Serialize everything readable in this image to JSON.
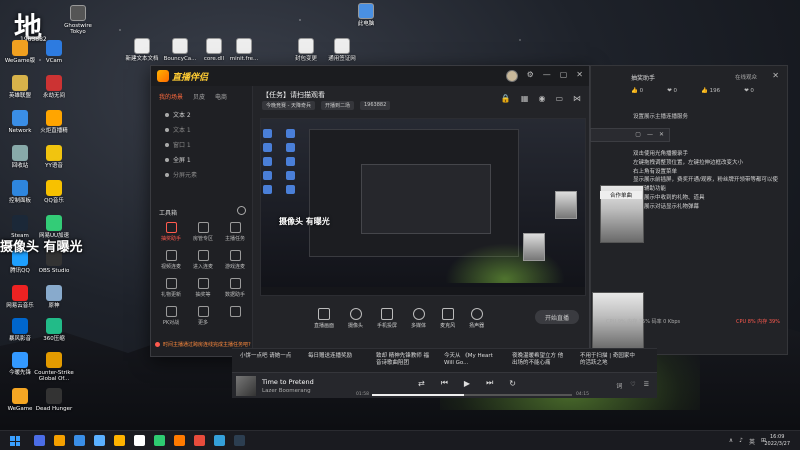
{
  "desktop": {
    "watermark": "摄像头 有曝光",
    "user_badge": {
      "glyph": "地",
      "text": "坐|观|于",
      "id": "1963882"
    },
    "icons": [
      {
        "label": "WeGame版",
        "color": "#f0a020"
      },
      {
        "label": "VCam",
        "color": "#2d7be0"
      },
      {
        "label": "英雄联盟",
        "color": "#d7b24a"
      },
      {
        "label": "永劫无间",
        "color": "#c33"
      },
      {
        "label": "Network",
        "color": "#3a8ee6"
      },
      {
        "label": "火炬直播精",
        "color": "#ffa500"
      },
      {
        "label": "回收站",
        "color": "#8aa"
      },
      {
        "label": "YY语音",
        "color": "#f1c40f"
      },
      {
        "label": "控制面板",
        "color": "#2e86de"
      },
      {
        "label": "QQ音乐",
        "color": "#f7c100"
      },
      {
        "label": "Steam",
        "color": "#1b2838"
      },
      {
        "label": "网易UU加速",
        "color": "#3c7"
      },
      {
        "label": "腾讯QQ",
        "color": "#1ea0ff"
      },
      {
        "label": "OBS Studio",
        "color": "#333"
      },
      {
        "label": "网易云音乐",
        "color": "#e22"
      },
      {
        "label": "原神",
        "color": "#8ac"
      },
      {
        "label": "暴风影音",
        "color": "#06c"
      },
      {
        "label": "360压缩",
        "color": "#2b8"
      },
      {
        "label": "今暖先锋",
        "color": "#39f"
      },
      {
        "label": "Counter-Strike Global Of...",
        "color": "#e39b00"
      },
      {
        "label": "WeGame",
        "color": "#f5a623"
      },
      {
        "label": "Dead Hunger",
        "color": "#333"
      }
    ],
    "top_icons": [
      {
        "label": "Ghostwire Tokyo",
        "color": "#555"
      },
      {
        "label": "新建文本文档",
        "color": "#eee"
      },
      {
        "label": "BouncyCa...",
        "color": "#eee"
      },
      {
        "label": "core.dll",
        "color": "#eee"
      },
      {
        "label": "minit.fre...",
        "color": "#eee"
      },
      {
        "label": "封包变更",
        "color": "#eee"
      },
      {
        "label": "通用签证网",
        "color": "#eee"
      },
      {
        "label": "此电脑",
        "color": "#4a90e2"
      }
    ]
  },
  "app": {
    "logo_text": "直播伴侣",
    "side_tabs": [
      "我的场景",
      "贝皮",
      "电商"
    ],
    "scenes": [
      {
        "label": "文本 2",
        "muted": false
      },
      {
        "label": "文本 1",
        "muted": true
      },
      {
        "label": "窗口 1",
        "muted": true
      },
      {
        "label": "全屏 1",
        "muted": false
      },
      {
        "label": "分屏元素",
        "muted": true
      }
    ],
    "tools_title": "工具箱",
    "tools": [
      {
        "label": "抽奖助手",
        "hot": true
      },
      {
        "label": "房管专区",
        "hot": false
      },
      {
        "label": "主播任务",
        "hot": false
      },
      {
        "label": "视频连麦",
        "hot": false
      },
      {
        "label": "进入连麦",
        "hot": false
      },
      {
        "label": "游戏连麦",
        "hot": false
      },
      {
        "label": "礼物更新",
        "hot": false
      },
      {
        "label": "抽奖等",
        "hot": false
      },
      {
        "label": "数据助手",
        "hot": false
      },
      {
        "label": "PK对战",
        "hot": false
      },
      {
        "label": "更多",
        "hot": false
      },
      {
        "label": "",
        "hot": false
      }
    ],
    "sidebar_notice": "时间主播通过跨房连线完成主播任务吧?",
    "room_title": "【任务】请扫描观看",
    "room_meta": [
      "今晚竞赛 - 天降奇兵",
      "开播到二场",
      "1963882"
    ],
    "preview_label": "摄像头 有曝光",
    "controls": [
      "直播画面",
      "摄像头",
      "手机投屏",
      "多媒体",
      "麦克风",
      "扬声器"
    ],
    "golive_label": "开始直播"
  },
  "ticker": {
    "user": "小饼一点吧 请她一点",
    "items": [
      "每日赠送连播奖励",
      "致却 精神先锋教师 福音诗歌曲阻团",
      "今天从 《My Heart Will Go...",
      "夜晚温暖希望立方 他出场的不能心痛",
      "不用于扫描 | 奇园家中的活跃之地"
    ]
  },
  "player": {
    "song": "Time to Pretend",
    "artist": "Lazer Boomerang",
    "time_current": "01:58",
    "time_total": "04:15",
    "progress": 0.46,
    "extra": [
      "词",
      "♡",
      "☰"
    ]
  },
  "right_panel": {
    "title": "抽奖助手",
    "online": "在线观众",
    "likes": [
      "👍 0",
      "❤ 0",
      "👍 196",
      "❤ 0"
    ],
    "subtitle": "设置展示主播连播服务",
    "tips": [
      "双击使用光角播搬录手",
      "左键拖拽调整顶位置，左键拉伸边框改变大小",
      "右上角有设置菜单",
      "显示展示前插屏，费奖开通/观察，粉丝牌开领带等都可以使用的辅助功能",
      "设置展示中收到的礼物、道具",
      "提示展示对话显示礼物弹幕"
    ],
    "photo_caption": "合作单曲",
    "stats_left": "CPU 9% 内存 35% 码率 0 Kbps",
    "stats_right": "CPU 8% 内存 39%"
  },
  "taskbar": {
    "clock_time": "16:09",
    "clock_date": "2022/3/27",
    "tray": [
      "∧",
      "♪",
      "英",
      "⊞"
    ],
    "icons": [
      "#4b6de6",
      "#f4a000",
      "#3a8ee6",
      "#5bb0ff",
      "#ffb300",
      "#fff",
      "#2ecc71",
      "#ff7a00",
      "#e74c3c",
      "#34a0d9",
      "#2c3e50"
    ]
  }
}
